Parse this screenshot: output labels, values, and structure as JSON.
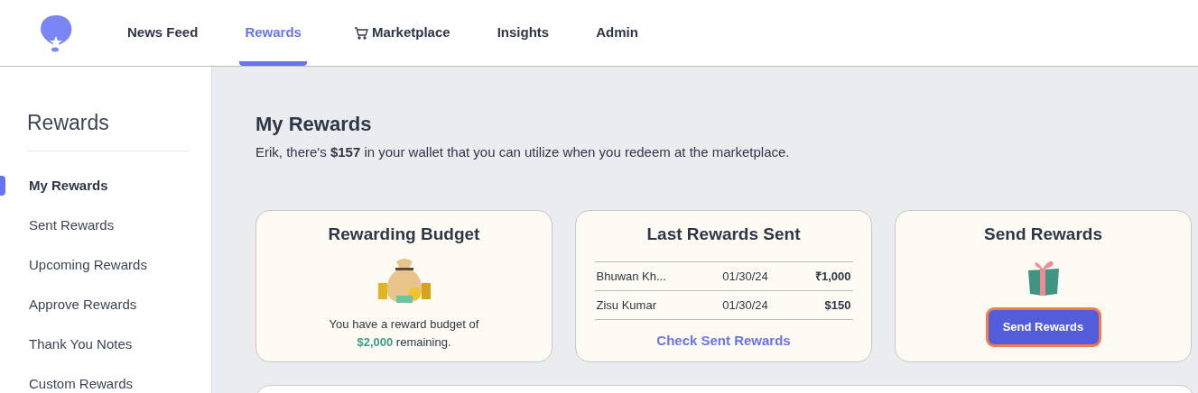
{
  "nav": [
    {
      "label": "News Feed",
      "selected": false,
      "kind": "page"
    },
    {
      "label": "Rewards",
      "selected": true,
      "kind": "page"
    },
    {
      "label": "Marketplace",
      "selected": false,
      "kind": "shop"
    },
    {
      "label": "Insights",
      "selected": false,
      "kind": "page"
    },
    {
      "label": "Admin",
      "selected": false,
      "kind": "page"
    }
  ],
  "sidebar": {
    "title": "Rewards",
    "items": [
      {
        "label": "My Rewards",
        "selected": true
      },
      {
        "label": "Sent Rewards",
        "selected": false
      },
      {
        "label": "Upcoming Rewards",
        "selected": false
      },
      {
        "label": "Approve Rewards",
        "selected": false
      },
      {
        "label": "Thank You Notes",
        "selected": false
      },
      {
        "label": "Custom Rewards",
        "selected": false
      }
    ]
  },
  "page": {
    "title": "My Rewards",
    "subtitle": "Erik, there's **$157** in your wallet that you can utilize when you redeem at the marketplace."
  },
  "budget_card": {
    "title": "Rewarding Budget",
    "text_before": "You have a reward budget of",
    "amount": "$2,000",
    "text_after": "remaining."
  },
  "last_sent_card": {
    "title": "Last Rewards Sent",
    "rows": [
      {
        "name": "Bhuwan Kh...",
        "date": "01/30/24",
        "amount": "₹1,000"
      },
      {
        "name": "Zisu Kumar",
        "date": "01/30/24",
        "amount": "$150"
      }
    ],
    "link": "Check Sent Rewards"
  },
  "send_card": {
    "title": "Send Rewards",
    "button": {
      "label": "Send Rewards",
      "focused": true
    }
  }
}
